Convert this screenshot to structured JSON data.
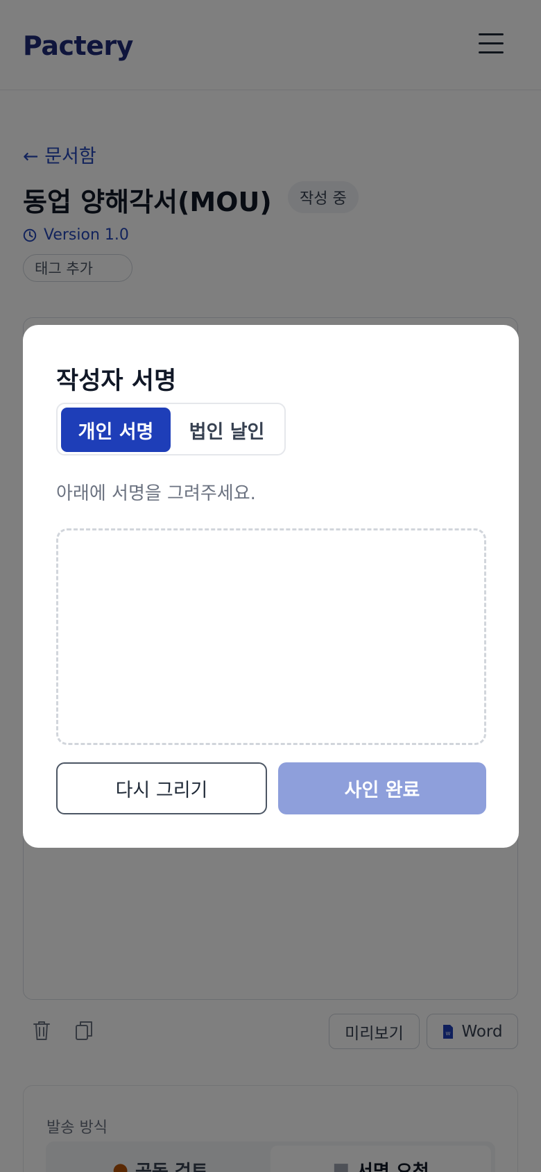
{
  "header": {
    "logo": "Pactery",
    "menu_icon": "hamburger-menu-icon"
  },
  "document": {
    "back_link": "← 문서함",
    "title": "동업 양해각서(MOU)",
    "status": "작성 중",
    "version": "Version 1.0",
    "tag_button": "태그 추가"
  },
  "toolbar": {
    "delete_icon": "trash-icon",
    "copy_icon": "copy-icon",
    "preview_label": "미리보기",
    "word_label": "Word"
  },
  "send": {
    "label": "발송 방식",
    "tabs": [
      {
        "label": "공동 검토",
        "icon": "fire-icon",
        "active": false
      },
      {
        "label": "서명 요청",
        "icon": "document-icon",
        "active": true
      }
    ]
  },
  "modal": {
    "title": "작성자 서명",
    "tabs": [
      {
        "label": "개인 서명",
        "active": true
      },
      {
        "label": "법인 날인",
        "active": false
      }
    ],
    "hint": "아래에 서명을 그려주세요.",
    "redraw_label": "다시 그리기",
    "complete_label": "사인 완료"
  },
  "colors": {
    "brand": "#1e2a78",
    "accent": "#1e3eb8",
    "link": "#2446b8",
    "complete_disabled": "#8e9fdb",
    "overlay": "rgba(0,0,0,0.5)"
  }
}
